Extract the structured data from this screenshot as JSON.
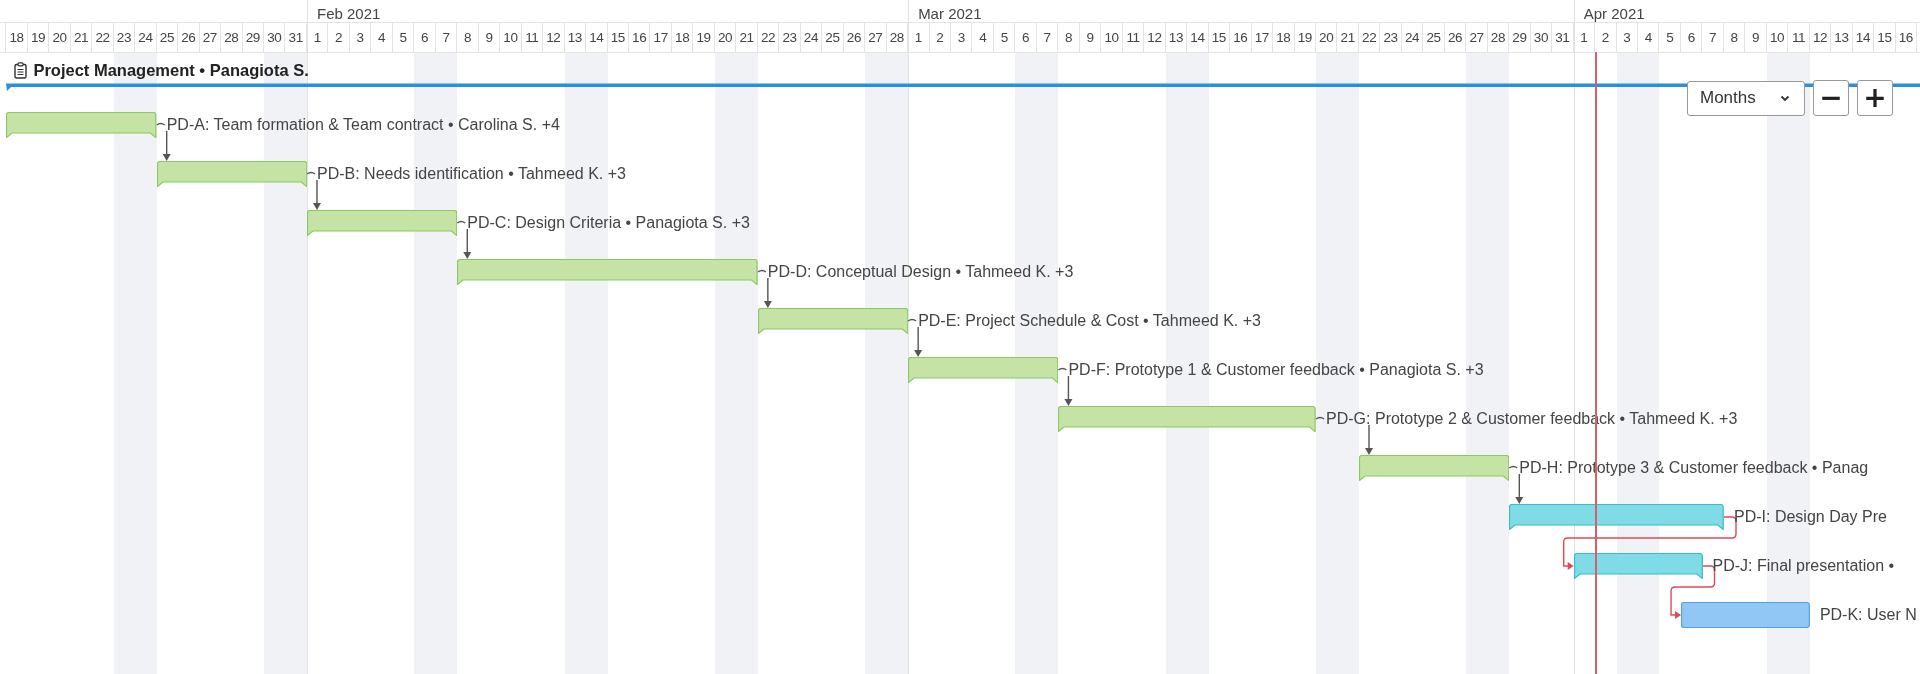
{
  "months": [
    {
      "label": "Feb 2021"
    },
    {
      "label": "Mar 2021"
    },
    {
      "label": "Apr 2021"
    }
  ],
  "days": [
    "18",
    "19",
    "20",
    "21",
    "22",
    "23",
    "24",
    "25",
    "26",
    "27",
    "28",
    "29",
    "30",
    "31",
    "1",
    "2",
    "3",
    "4",
    "5",
    "6",
    "7",
    "8",
    "9",
    "10",
    "11",
    "12",
    "13",
    "14",
    "15",
    "16",
    "17",
    "18",
    "19",
    "20",
    "21",
    "22",
    "23",
    "24",
    "25",
    "26",
    "27",
    "28",
    "1",
    "2",
    "3",
    "4",
    "5",
    "6",
    "7",
    "8",
    "9",
    "10",
    "11",
    "12",
    "13",
    "14",
    "15",
    "16",
    "17",
    "18",
    "19",
    "20",
    "21",
    "22",
    "23",
    "24",
    "25",
    "26",
    "27",
    "28",
    "29",
    "30",
    "31",
    "1",
    "2",
    "3",
    "4",
    "5",
    "6",
    "7",
    "8",
    "9",
    "10",
    "11",
    "12",
    "13",
    "14",
    "15",
    "16"
  ],
  "project": {
    "title": "Project Management • Panagiota S."
  },
  "toolbar": {
    "zoom_select": "Months",
    "buttons": [
      "−",
      "+"
    ]
  },
  "tasks": [
    {
      "label": "PD-A: Team formation & Team contract • Carolina S. +4",
      "color": "#c5e3a5",
      "kind": "notched"
    },
    {
      "label": "PD-B: Needs identification • Tahmeed K. +3",
      "color": "#c5e3a5",
      "kind": "notched"
    },
    {
      "label": "PD-C: Design Criteria • Panagiota S. +3",
      "color": "#c5e3a5",
      "kind": "notched"
    },
    {
      "label": "PD-D: Conceptual Design • Tahmeed K. +3",
      "color": "#c5e3a5",
      "kind": "notched"
    },
    {
      "label": "PD-E: Project Schedule & Cost • Tahmeed K. +3",
      "color": "#c5e3a5",
      "kind": "notched"
    },
    {
      "label": "PD-F: Prototype 1 & Customer feedback • Panagiota S. +3",
      "color": "#c5e3a5",
      "kind": "notched"
    },
    {
      "label": "PD-G: Prototype 2 & Customer feedback • Tahmeed K. +3",
      "color": "#c5e3a5",
      "kind": "notched"
    },
    {
      "label": "PD-H: Prototype 3 & Customer feedback • Panag",
      "color": "#c5e3a5",
      "kind": "notched"
    },
    {
      "label": "PD-I: Design Day Pre",
      "color": "#7fdbe6",
      "kind": "notched"
    },
    {
      "label": "PD-J: Final presentation •",
      "color": "#7fdbe6",
      "kind": "notched"
    },
    {
      "label": "PD-K: User N",
      "color": "#90c7f5",
      "kind": "plain"
    }
  ],
  "dependencies": [
    {
      "critical": false
    },
    {
      "critical": false
    },
    {
      "critical": false
    },
    {
      "critical": false
    },
    {
      "critical": false
    },
    {
      "critical": false
    },
    {
      "critical": false
    },
    {
      "critical": false
    },
    {
      "critical": true
    },
    {
      "critical": true
    }
  ]
}
